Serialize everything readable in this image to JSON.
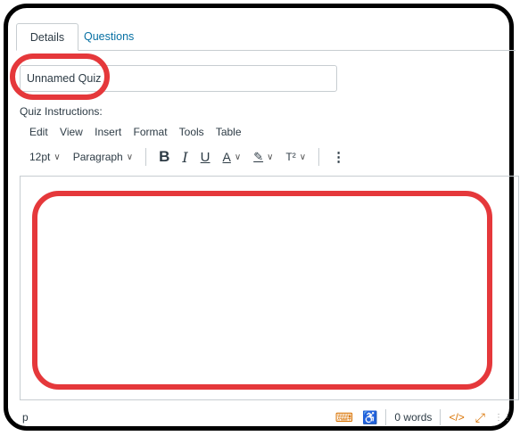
{
  "tabs": [
    {
      "label": "Details",
      "active": true
    },
    {
      "label": "Questions",
      "active": false
    }
  ],
  "quiz_title": "Unnamed Quiz",
  "instructions_label": "Quiz Instructions:",
  "menubar": [
    "Edit",
    "View",
    "Insert",
    "Format",
    "Tools",
    "Table"
  ],
  "toolbar": {
    "font_size": "12pt",
    "block_format": "Paragraph",
    "bold": "B",
    "italic": "I",
    "underline": "U",
    "text_color": "A",
    "highlight": "✎",
    "superscript": "T²",
    "more": "⋮"
  },
  "statusbar": {
    "path": "p",
    "word_count": "0 words",
    "html_toggle": "</>"
  },
  "colors": {
    "link": "#0770a3",
    "annotation": "#e5383b",
    "status_icon": "#d97200"
  }
}
